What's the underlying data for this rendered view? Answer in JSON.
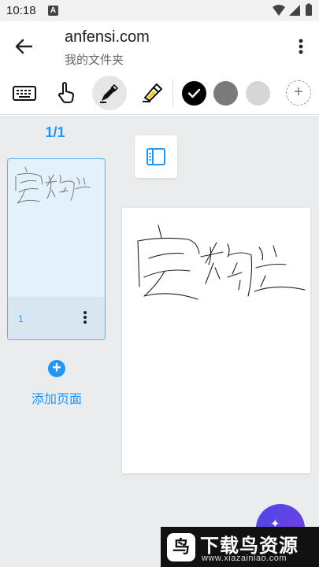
{
  "status_bar": {
    "time": "10:18",
    "notification_icon": "A"
  },
  "app_bar": {
    "title": "anfensi.com",
    "subtitle": "我的文件夹"
  },
  "toolbar": {
    "tools": [
      "keyboard-icon",
      "hand-touch-icon",
      "pen-icon",
      "highlighter-icon"
    ],
    "selected_tool": "pen-icon",
    "colors": [
      "#000000",
      "#7a7a7a",
      "#d6d6d6"
    ],
    "selected_color": "#000000",
    "add_color_symbol": "+"
  },
  "sidebar": {
    "page_indicator": "1/1",
    "pages": [
      {
        "number": "1"
      }
    ],
    "add_page_symbol": "+",
    "add_page_label": "添加页面"
  },
  "colors": {
    "accent": "#2196f3",
    "fab_start": "#4b49e8",
    "fab_end": "#7c3be0"
  },
  "fab": {
    "icon": "sparkle-icon"
  },
  "watermark": {
    "title": "下载鸟资源",
    "url": "www.xiazainiao.com",
    "logo": "鸟"
  }
}
